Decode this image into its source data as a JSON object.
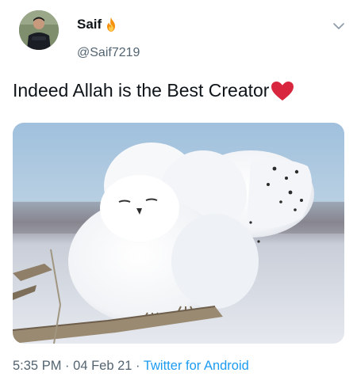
{
  "user": {
    "display_name": "Saif",
    "handle": "@Saif7219"
  },
  "tweet": {
    "text": "Indeed Allah is the Best Creator",
    "time": "5:35 PM",
    "separator": "·",
    "date": "04 Feb 21",
    "source": "Twitter for Android"
  },
  "icons": {
    "name_emoji": "fire-icon",
    "text_emoji": "red-heart-icon",
    "menu": "chevron-down-icon"
  },
  "colors": {
    "text": "#0f1419",
    "secondary": "#536471",
    "link": "#1d9bf0",
    "heart": "#d7263d"
  }
}
